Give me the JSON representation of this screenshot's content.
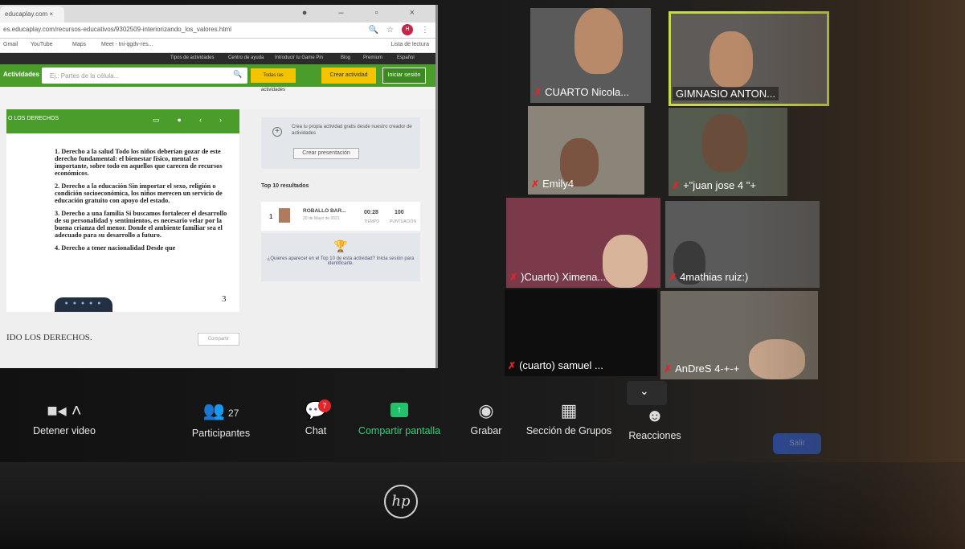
{
  "browser": {
    "tab_title": "educaplay.com ×",
    "url": "es.educaplay.com/recursos-educativos/9302509-interiorizando_los_valores.html",
    "profile_initial": "H",
    "bookmarks": [
      "Gmail",
      "YouTube",
      "Maps",
      "Meet - tni-qgdv-res..."
    ],
    "reading_list": "Lista de lectura"
  },
  "site": {
    "topnav": [
      "Tipos de actividades",
      "Centro de ayuda",
      "Introducir tu Game Pin",
      "Blog",
      "Premium",
      "Español"
    ],
    "activities_label": "Actividades",
    "search_placeholder": "Ej.: Partes de la célula...",
    "all_activities": "Todas las actividades",
    "create_activity": "Crear actividad",
    "login": "Iniciar sesión",
    "panel_title": "O LOS DERECHOS",
    "paragraphs": [
      "1. Derecho a la salud Todo los niños deberían gozar de este derecho fundamental: el bienestar físico, mental es importante, sobre todo en aquellos que carecen de recursos económicos.",
      "2. Derecho a la educación Sin importar el sexo, religión o condición socioeconómica, los niños merecen un servicio de educación gratuito con apoyo del estado.",
      "3. Derecho a una familia Si buscamos fortalecer el desarrollo de su personalidad y sentimientos, es necesario velar por la buena crianza del menor. Donde el ambiente familiar sea el adecuado para su desarrollo a futuro.",
      "4. Derecho a tener nacionalidad Desde que"
    ],
    "page_number": "3",
    "bottom_title": "IDO LOS DERECHOS.",
    "share": "Compartir",
    "create_card_text": "Crea tu propia actividad gratis desde nuestro creador de actividades",
    "create_presentation": "Crear presentación",
    "top10_title": "Top 10 resultados",
    "result": {
      "rank": "1",
      "name": "ROBALLO BAR...",
      "date": "20 de Mayo de 2021",
      "time": "00:28",
      "time_label": "TIEMPO",
      "score": "100",
      "score_label": "PUNTUACIÓN"
    },
    "appear_text": "¿Quieres aparecer en el Top 10 de esta actividad? Inicia sesión para identificarte."
  },
  "participants_tiles": [
    {
      "name": "CUARTO Nicola..."
    },
    {
      "name": "GIMNASIO ANTON..."
    },
    {
      "name": "Emily4"
    },
    {
      "name": "+\"juan jose 4 \"+"
    },
    {
      "name": ")Cuarto) Ximena..."
    },
    {
      "name": "4mathias ruiz:)"
    },
    {
      "name": "(cuarto) samuel ..."
    },
    {
      "name": "AnDreS 4-+-+"
    }
  ],
  "toolbar": {
    "stop_video": "Detener video",
    "participants": "Participantes",
    "participants_count": "27",
    "chat": "Chat",
    "chat_badge": "7",
    "share_screen": "Compartir pantalla",
    "record": "Grabar",
    "breakout": "Sección de Grupos",
    "reactions": "Reacciones",
    "leave": "Salir"
  },
  "laptop_brand": "hp",
  "colors": {
    "site_green": "#4a9d2a",
    "zoom_share_green": "#23c16b",
    "mic_muted_red": "#e0262b",
    "active_speaker_border": "#c8d94a"
  }
}
